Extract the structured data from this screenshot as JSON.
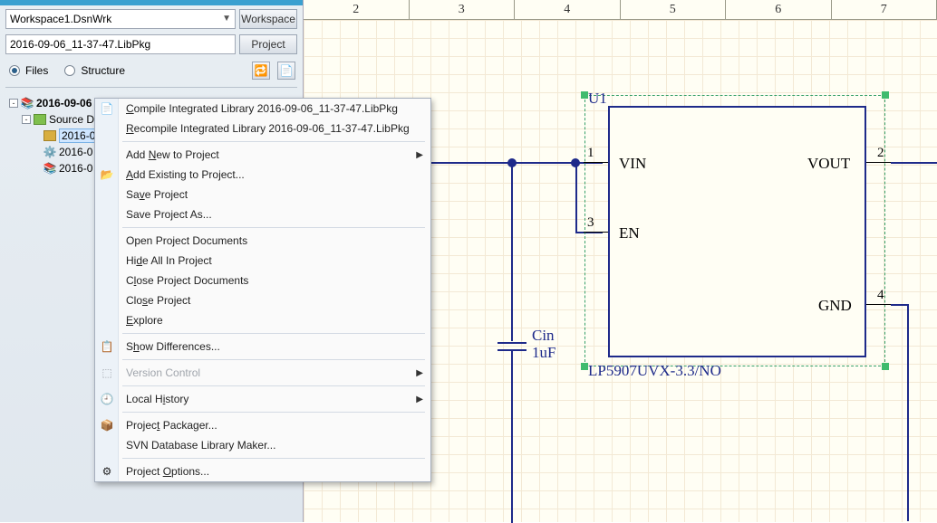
{
  "panel": {
    "workspace_value": "Workspace1.DsnWrk",
    "workspace_btn": "Workspace",
    "project_value": "2016-09-06_11-37-47.LibPkg",
    "project_btn": "Project",
    "radio_files": "Files",
    "radio_structure": "Structure",
    "tree": {
      "root": "2016-09-06",
      "src": "Source D",
      "sel": "2016-0",
      "doc1": "2016-0",
      "doc2": "2016-0"
    }
  },
  "menu": {
    "items": [
      {
        "label_html": "<u>C</u>ompile Integrated Library 2016-09-06_11-37-47.LibPkg",
        "icon": "📄"
      },
      {
        "label_html": "<u>R</u>ecompile Integrated Library 2016-09-06_11-37-47.LibPkg"
      },
      {
        "sep": true
      },
      {
        "label_html": "Add <u>N</u>ew to Project",
        "arrow": true
      },
      {
        "label_html": "<u>A</u>dd Existing to Project...",
        "icon": "📂"
      },
      {
        "label_html": "Sa<u>v</u>e Project"
      },
      {
        "label_html": "Save Pro<u>j</u>ect As..."
      },
      {
        "sep": true
      },
      {
        "label_html": "Open Project Documents"
      },
      {
        "label_html": "Hi<u>d</u>e All In Project"
      },
      {
        "label_html": "C<u>l</u>ose Project Documents"
      },
      {
        "label_html": "Clo<u>s</u>e Project"
      },
      {
        "label_html": "<u>E</u>xplore"
      },
      {
        "sep": true
      },
      {
        "label_html": "S<u>h</u>ow Differences...",
        "icon": "📋"
      },
      {
        "sep": true
      },
      {
        "label_html": "Version Control",
        "arrow": true,
        "disabled": true,
        "icon": "⬚"
      },
      {
        "sep": true
      },
      {
        "label_html": "Local H<u>i</u>story",
        "arrow": true,
        "icon": "🕘"
      },
      {
        "sep": true
      },
      {
        "label_html": "Projec<u>t</u> Packager...",
        "icon": "📦"
      },
      {
        "label_html": "SVN Database Library Maker..."
      },
      {
        "sep": true
      },
      {
        "label_html": "Project <u>O</u>ptions...",
        "icon": "⚙"
      }
    ]
  },
  "ruler": [
    "2",
    "3",
    "4",
    "5",
    "6",
    "7"
  ],
  "schematic": {
    "designator": "U1",
    "part": "LP5907UVX-3.3/NO",
    "pins": [
      {
        "num": "1",
        "name": "VIN"
      },
      {
        "num": "2",
        "name": "VOUT"
      },
      {
        "num": "3",
        "name": "EN"
      },
      {
        "num": "4",
        "name": "GND"
      }
    ],
    "cap_ref": "Cin",
    "cap_val": "1uF"
  }
}
